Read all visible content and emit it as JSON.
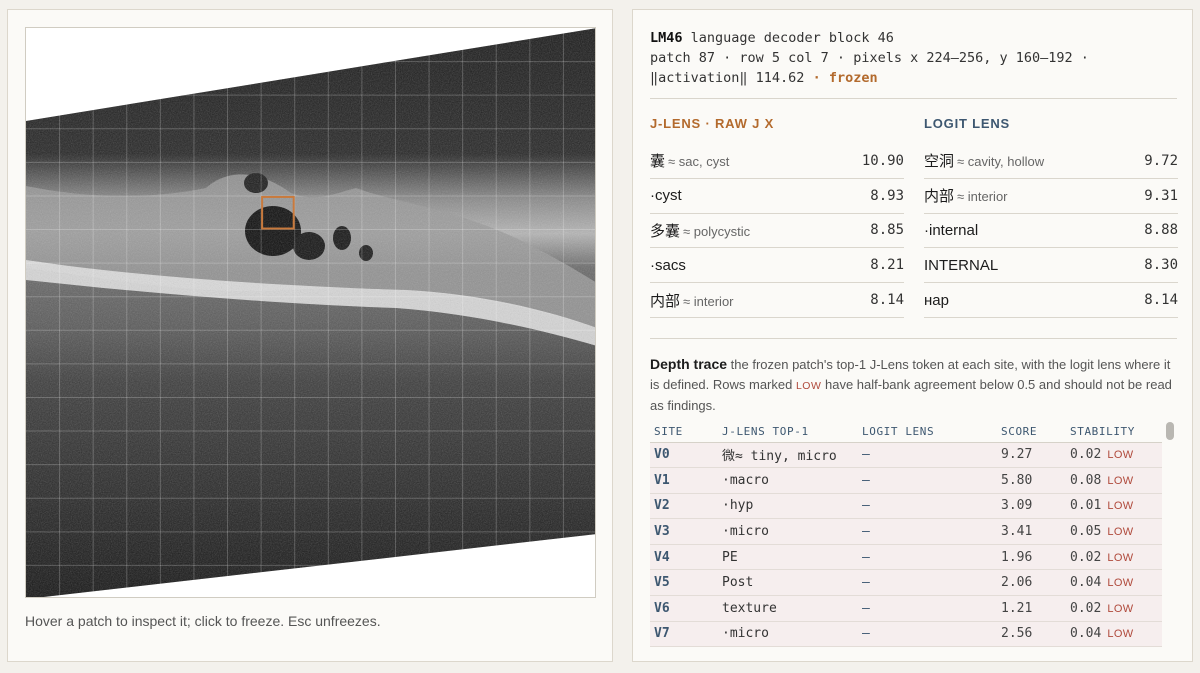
{
  "viewer": {
    "hint": "Hover a patch to inspect it; click to freeze. Esc unfreezes.",
    "grid": {
      "cols": 17,
      "rows": 17
    },
    "selected_patch": {
      "row": 5,
      "col": 7
    }
  },
  "inspector": {
    "layer_id": "LM46",
    "layer_desc": "language decoder block 46",
    "patch_line": "patch 87 · row 5 col 7 · pixels x 224–256, y 160–192 ·",
    "activation_label": "‖activation‖ 114.62",
    "frozen_label": "· frozen",
    "jlens": {
      "title": "J-LENS · RAW J X",
      "rows": [
        {
          "token": "囊",
          "gloss": "≈ sac, cyst",
          "score": "10.90"
        },
        {
          "token": "·cyst",
          "gloss": "",
          "score": "8.93"
        },
        {
          "token": "多囊",
          "gloss": "≈ polycystic",
          "score": "8.85"
        },
        {
          "token": "·sacs",
          "gloss": "",
          "score": "8.21"
        },
        {
          "token": "内部",
          "gloss": "≈ interior",
          "score": "8.14"
        }
      ]
    },
    "logit": {
      "title": "LOGIT LENS",
      "rows": [
        {
          "token": "空洞",
          "gloss": "≈ cavity, hollow",
          "score": "9.72"
        },
        {
          "token": "内部",
          "gloss": "≈ interior",
          "score": "9.31"
        },
        {
          "token": "·internal",
          "gloss": "",
          "score": "8.88"
        },
        {
          "token": "INTERNAL",
          "gloss": "",
          "score": "8.30"
        },
        {
          "token": "нар",
          "gloss": "",
          "score": "8.14"
        }
      ]
    },
    "depth_trace": {
      "title": "Depth trace",
      "desc_a": " the frozen patch's top-1 J-Lens token at each site, with the logit lens where it is defined. Rows marked ",
      "low_tag": "LOW",
      "desc_b": " have half-bank agreement below 0.5 and should not be read as findings.",
      "columns": [
        "SITE",
        "J-LENS TOP-1",
        "LOGIT LENS",
        "SCORE",
        "STABILITY"
      ],
      "rows": [
        {
          "site": "V0",
          "jlens": "微≈ tiny, micro",
          "logit": "—",
          "score": "9.27",
          "stability": "0.02",
          "flag": "LOW"
        },
        {
          "site": "V1",
          "jlens": "·macro",
          "logit": "—",
          "score": "5.80",
          "stability": "0.08",
          "flag": "LOW"
        },
        {
          "site": "V2",
          "jlens": "·hyp",
          "logit": "—",
          "score": "3.09",
          "stability": "0.01",
          "flag": "LOW"
        },
        {
          "site": "V3",
          "jlens": "·micro",
          "logit": "—",
          "score": "3.41",
          "stability": "0.05",
          "flag": "LOW"
        },
        {
          "site": "V4",
          "jlens": "PE",
          "logit": "—",
          "score": "1.96",
          "stability": "0.02",
          "flag": "LOW"
        },
        {
          "site": "V5",
          "jlens": "Post",
          "logit": "—",
          "score": "2.06",
          "stability": "0.04",
          "flag": "LOW"
        },
        {
          "site": "V6",
          "jlens": "texture",
          "logit": "—",
          "score": "1.21",
          "stability": "0.02",
          "flag": "LOW"
        },
        {
          "site": "V7",
          "jlens": "·micro",
          "logit": "—",
          "score": "2.56",
          "stability": "0.04",
          "flag": "LOW"
        }
      ]
    }
  },
  "colors": {
    "accent": "#b36a2d",
    "site_blue": "#3d5770",
    "low_red": "#b04a3c",
    "row_tint": "#f6eeee"
  }
}
